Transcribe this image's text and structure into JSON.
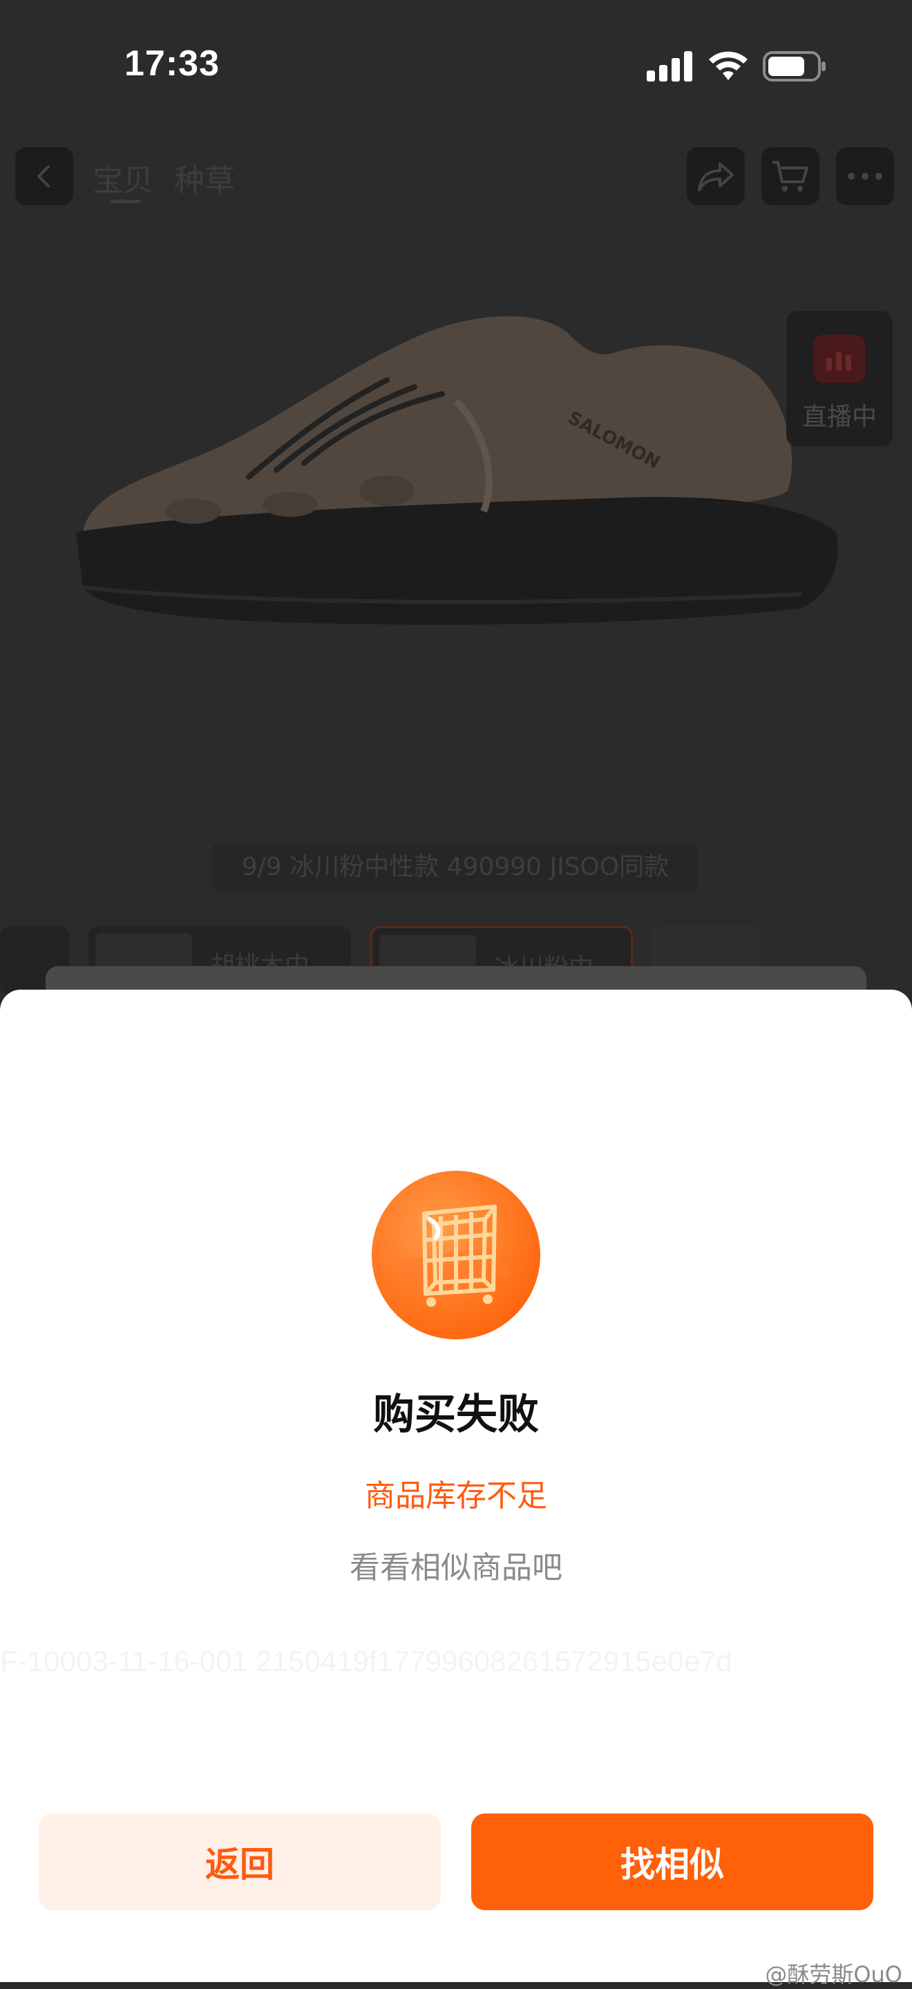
{
  "status_bar": {
    "time": "17:33",
    "icons": [
      "signal-icon",
      "wifi-icon",
      "battery-icon"
    ]
  },
  "nav": {
    "tabs": [
      "宝贝",
      "种草"
    ],
    "icons": [
      "back-icon",
      "share-icon",
      "cart-icon",
      "more-icon"
    ]
  },
  "live": {
    "label": "直播中"
  },
  "gallery": {
    "caption": "9/9 冰川粉中性款 490990 JISOO同款",
    "brand_text": "SALOMON"
  },
  "variants": [
    {
      "label": "胡桃木中"
    },
    {
      "label": "冰川粉中",
      "selected": true
    }
  ],
  "dialog": {
    "title": "购买失败",
    "reason": "商品库存不足",
    "hint": "看看相似商品吧",
    "trace_id": "F-10003-11-16-001 2150419f17799608261572915e0e7d",
    "back_label": "返回",
    "similar_label": "找相似"
  },
  "footer": {
    "watermark": "@酥劳斯OuO"
  },
  "colors": {
    "accent": "#ff600a",
    "accent_light": "#fff0e8",
    "reason_text": "#ff5a10"
  }
}
